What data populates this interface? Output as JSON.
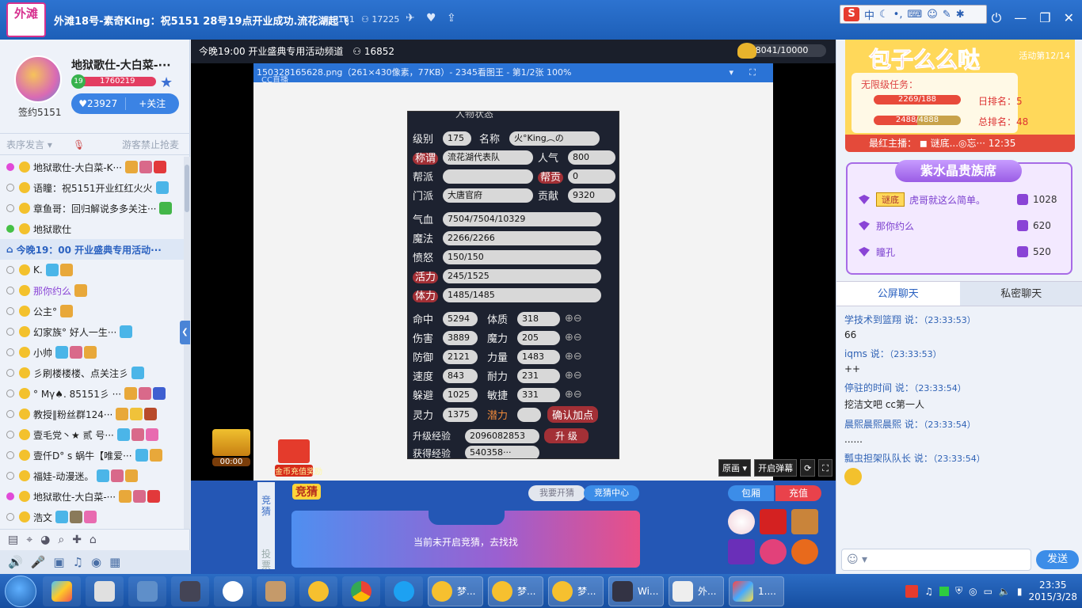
{
  "titlebar": {
    "logo": "外滩",
    "room_title": "外滩18号-素奇King：祝5151 28号19点开业成功.流花湖起飞",
    "room_id": "5151",
    "viewers": "17225"
  },
  "ime": {
    "mode": "中"
  },
  "left": {
    "host_name": "地狱歌仕-大白菜-···",
    "sign_label": "签约5151",
    "level": "19",
    "points": "1760219",
    "likes": "23927",
    "follow_label": "+关注",
    "filter_sort": "表序发言",
    "filter_guest": "游客禁止抢麦",
    "list": [
      {
        "dot": "pink",
        "text": "地狱歌仕-大白菜-K···"
      },
      {
        "dot": "none",
        "text": "语瞳：祝5151开业红红火火"
      },
      {
        "dot": "none",
        "text": "章鱼哥：回归解说多多关注···"
      },
      {
        "dot": "green",
        "text": "地狱歌仕"
      },
      {
        "dot": "notice",
        "text": "今晚19：00 开业盛典专用活动···"
      },
      {
        "dot": "none",
        "text": "K."
      },
      {
        "dot": "none",
        "text": "那你约么"
      },
      {
        "dot": "none",
        "text": "公主°"
      },
      {
        "dot": "none",
        "text": "幻家族° 好人一生···"
      },
      {
        "dot": "none",
        "text": "小帅"
      },
      {
        "dot": "none",
        "text": "彡刷楼楼楼、点关注彡"
      },
      {
        "dot": "none",
        "text": "° Mγ♠. 85151彡 ···"
      },
      {
        "dot": "none",
        "text": "教授‖粉丝群124···"
      },
      {
        "dot": "none",
        "text": "壹毛党丶★ 贰 号···"
      },
      {
        "dot": "none",
        "text": "壹仟D° s 蜗牛【唯爱···"
      },
      {
        "dot": "none",
        "text": "福娃-动漫迷。"
      },
      {
        "dot": "pink",
        "text": "地狱歌仕-大白菜-···"
      },
      {
        "dot": "none",
        "text": "浩文"
      }
    ]
  },
  "stage": {
    "head": "今晚19:00 开业盛典专用活动频道",
    "head_viewers": "16852",
    "gold": "8041/10000",
    "viewer_title": "150328165628.png（261×430像素，77KB）- 2345看图王 - 第1/2张 100%",
    "cc_tag": "CC直播",
    "game": {
      "header": "人物状态",
      "level": "175",
      "name_label": "名称",
      "name": "火°King︵の",
      "title_label": "称谓",
      "title": "流花湖代表队",
      "pop_label": "人气",
      "pop": "800",
      "gang_label": "帮派",
      "contrib_label": "帮贡",
      "contrib": "0",
      "school_label": "门派",
      "school": "大唐官府",
      "merit_label": "贡献",
      "merit": "9320",
      "hp_label": "气血",
      "hp": "7504/7504/10329",
      "mp_label": "魔法",
      "mp": "2266/2266",
      "anger_label": "愤怒",
      "anger": "150/150",
      "vit_label": "活力",
      "vit": "245/1525",
      "sta_label": "体力",
      "sta": "1485/1485",
      "stats": [
        {
          "a": "命中",
          "av": "5294",
          "b": "体质",
          "bv": "318"
        },
        {
          "a": "伤害",
          "av": "3889",
          "b": "魔力",
          "bv": "205"
        },
        {
          "a": "防御",
          "av": "2121",
          "b": "力量",
          "bv": "1483"
        },
        {
          "a": "速度",
          "av": "843",
          "b": "耐力",
          "bv": "231"
        },
        {
          "a": "躲避",
          "av": "1025",
          "b": "敏捷",
          "bv": "331"
        }
      ],
      "spirit_label": "灵力",
      "spirit": "1375",
      "potential_label": "潜力",
      "confirm": "确认加点",
      "exp_label": "升级经验",
      "exp": "2096082853",
      "upgrade": "升 级",
      "gain_label": "获得经验",
      "gain": "540358···"
    },
    "orig_label": "原画",
    "danmaku_label": "开启弹幕",
    "treasure_time": "00:00",
    "gift_label": "金币充值奖励"
  },
  "guess": {
    "tab_a": "竞猜",
    "tab_b": "投票",
    "title": "竞猜",
    "my_label": "我要开猜",
    "center_label": "竞猜中心",
    "empty_text": "当前未开启竞猜，去找找",
    "wrap": "包厢",
    "recharge": "充值"
  },
  "right": {
    "host_title": "包子么么哒",
    "activity": "活动第12/14",
    "task_label": "无限级任务：",
    "bar1": "2269/188",
    "rank_day": "日排名：5",
    "bar2": "2488/4888",
    "rank_total": "总排名：48",
    "recent": "最红主播：  ◼ 谜底...◎忘··· 12:35",
    "noble_title": "紫水晶贵族席",
    "nobles": [
      {
        "badge": "谜底",
        "name": "虎哥就这么简单。",
        "val": "1028"
      },
      {
        "badge": "",
        "name": "那你约么",
        "val": "620"
      },
      {
        "badge": "",
        "name": "瞳孔",
        "val": "520"
      }
    ],
    "tab_public": "公屏聊天",
    "tab_private": "私密聊天",
    "chat": [
      {
        "who": "学技术到篮翔 说：",
        "time": "（23:33:53）",
        "body": "66"
      },
      {
        "who": "iqms 说：",
        "time": "（23:33:53）",
        "body": "++"
      },
      {
        "who": "停驻的时间 说：",
        "time": "（23:33:54）",
        "body": "挖洁文吧    cc第一人"
      },
      {
        "who": "晨熙晨熙晨熙 说：",
        "time": "（23:33:54）",
        "body": "......"
      },
      {
        "who": "瓢虫担架队队长 说：",
        "time": "（23:33:54）",
        "body": ""
      }
    ],
    "send": "发送"
  },
  "taskbar": {
    "windows": [
      {
        "label": "梦..."
      },
      {
        "label": "梦..."
      },
      {
        "label": "梦..."
      },
      {
        "label": "Wi..."
      },
      {
        "label": "外..."
      },
      {
        "label": "1...."
      }
    ],
    "time": "23:35",
    "date": "2015/3/28"
  }
}
